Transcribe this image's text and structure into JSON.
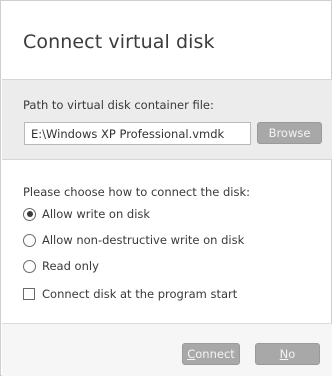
{
  "dialog": {
    "title": "Connect virtual disk"
  },
  "path_section": {
    "label": "Path to virtual disk container file:",
    "value": "E:\\Windows XP Professional.vmdk",
    "browse_label": "Browse"
  },
  "connect_mode": {
    "label": "Please choose how to connect the disk:",
    "options": [
      {
        "label": "Allow write on disk",
        "selected": true
      },
      {
        "label": "Allow non-destructive write on disk",
        "selected": false
      },
      {
        "label": "Read only",
        "selected": false
      }
    ]
  },
  "startup_checkbox": {
    "label": "Connect disk at the program start",
    "checked": false
  },
  "footer": {
    "connect_label": "Connect",
    "no_label": "No"
  },
  "colors": {
    "button_bg": "#a8a8a8",
    "panel_bg": "#ececec"
  }
}
